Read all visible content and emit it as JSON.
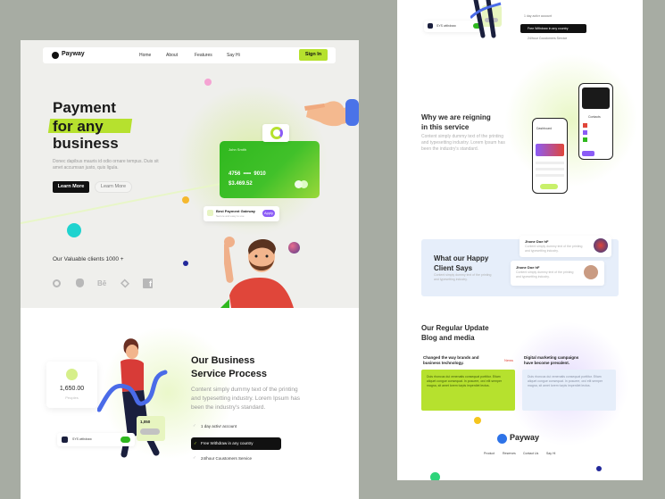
{
  "brand": "Payway",
  "nav": {
    "links": [
      "Home",
      "About",
      "Features",
      "Say Hi"
    ],
    "signin": "Sign In"
  },
  "hero": {
    "title_line1": "Payment",
    "title_line2": "for any",
    "title_line3": "business",
    "body_line1": "Donec dapibus mauris id odio ornare tempus. Duis sit",
    "body_line2": "amet accumsan justo, quis  ligula.",
    "primary_btn": "Learn More",
    "secondary_btn": "Learn More",
    "card": {
      "holder": "John Smith",
      "number": "4756  ••••  9010",
      "balance": "$3.469.52"
    },
    "gateway": {
      "title": "Best Payment Gateway",
      "subtitle": "Secure and easy to use",
      "pill": "Apply"
    },
    "clients_label": "Our Valuable clients 1000 +"
  },
  "process": {
    "title_line1": "Our Business",
    "title_line2": "Service Process",
    "body_line1": "Content simply dummy text of the printing",
    "body_line2": "and typesetting industry. Lorem Ipsum has",
    "body_line3": "been the industry's standard.",
    "stat_value": "1,650.00",
    "stat_label": "Peoples",
    "mini_stat": "1,050",
    "wd_label": "SYS withdraw",
    "steps": [
      "1 day activr account",
      "Free Withdraw in any country",
      "24/hour Coustomers Service"
    ]
  },
  "right": {
    "top_wd_label": "SYS withdraw",
    "top_steps": [
      "1 day activr account",
      "Free Withdraw in any country",
      "24/hour Coustomers Service"
    ],
    "reign": {
      "title_line1": "Why we are reigning",
      "title_line2": "in this service",
      "body_line1": "Content simply dummy text of the printing",
      "body_line2": "and typesetting industry. Lorem Ipsum has",
      "body_line3": "been the industry's standard."
    },
    "phone": {
      "dashboard": "Dashboard",
      "contacts": "Contacts"
    },
    "clients": {
      "title_line1": "What our Happy",
      "title_line2": "Client Says",
      "body_line1": "Content simply dummy text of the printing",
      "body_line2": "and typesetting industry.",
      "reviews": [
        {
          "name": "Jhone Doe hF",
          "text": "Content simply dummy text of the printing and typesetting industry."
        },
        {
          "name": "Jhone Doe hF",
          "text": "Content simply dummy text of the printing and typesetting industry."
        }
      ]
    },
    "blog": {
      "title_line1": "Our Regular Update",
      "title_line2": "Blog and media",
      "posts": [
        {
          "title_line1": "Changed the way brands and",
          "title_line2": "business technology.",
          "tag": "News",
          "body": "Duis rhoncus dui venenatis consequat porttitor. Etiam aliquet congue consequat. In posuere, orci elit semper magna, sit amet lorem turpis imperdiet lectus."
        },
        {
          "title_line1": "Digital marketing campaigns",
          "title_line2": "have become prevalent.",
          "tag": "",
          "body": "Duis rhoncus dui venenatis consequat porttitor. Etiam aliquet congue consequat. In posuere, orci elit semper magna, sit amet lorem turpis imperdiet lectus."
        }
      ]
    },
    "footer": {
      "brand": "Payway",
      "links": [
        "Product",
        "Reserves",
        "Contact Us",
        "Say Hi"
      ]
    }
  },
  "colors": {
    "accent": "#b6e12e",
    "card_green": "#2fb81e",
    "dark": "#111111",
    "purple": "#8b5cf6",
    "background": "#a7aca3"
  },
  "icons": [
    "chrome-icon",
    "apple-icon",
    "behance-icon",
    "dropbox-icon",
    "facebook-icon",
    "person-icon",
    "check-icon",
    "wallet-icon"
  ]
}
